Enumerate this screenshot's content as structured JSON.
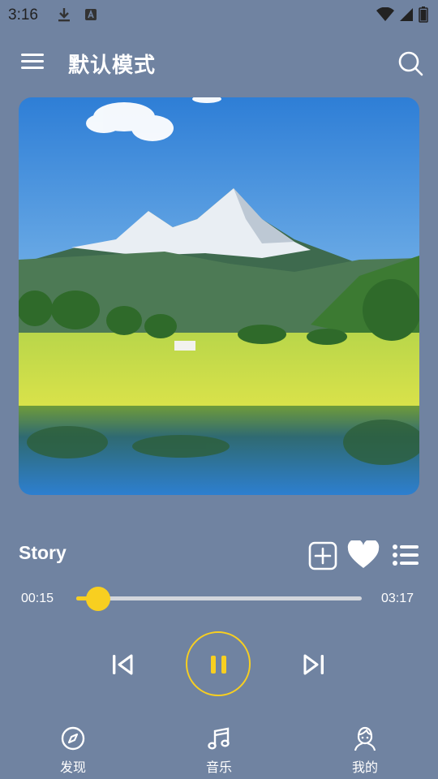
{
  "status_bar": {
    "time": "3:16"
  },
  "header": {
    "title": "默认模式"
  },
  "player": {
    "song_title": "Story",
    "elapsed": "00:15",
    "duration": "03:17",
    "progress": 0.076,
    "state": "playing"
  },
  "nav": {
    "items": [
      {
        "label": "发现",
        "icon": "compass-icon"
      },
      {
        "label": "音乐",
        "icon": "music-note-icon"
      },
      {
        "label": "我的",
        "icon": "person-icon"
      }
    ]
  },
  "colors": {
    "background": "#7083a1",
    "accent": "#f8cf20",
    "track": "#d3d6dc"
  }
}
